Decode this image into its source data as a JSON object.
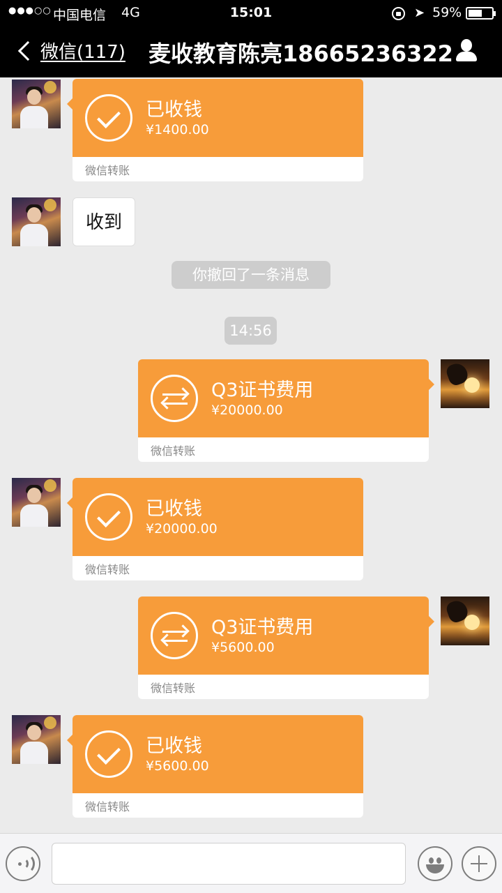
{
  "status_bar": {
    "signal": "●●●○○",
    "carrier": "中国电信",
    "network": "4G",
    "time": "15:01",
    "battery_percent": "59%",
    "battery_level": 0.59
  },
  "nav": {
    "back_label": "微信(117)",
    "title": "麦收教育陈亮18665236322"
  },
  "messages": [
    {
      "title": "已收钱",
      "amount": "¥1400.00",
      "footer": "微信转账"
    },
    {
      "text": "收到"
    },
    {
      "system": "你撤回了一条消息"
    },
    {
      "timestamp": "14:56"
    },
    {
      "title": "Q3证书费用",
      "amount": "¥20000.00",
      "footer": "微信转账"
    },
    {
      "title": "已收钱",
      "amount": "¥20000.00",
      "footer": "微信转账"
    },
    {
      "title": "Q3证书费用",
      "amount": "¥5600.00",
      "footer": "微信转账"
    },
    {
      "title": "已收钱",
      "amount": "¥5600.00",
      "footer": "微信转账"
    }
  ],
  "colors": {
    "transfer_orange": "#f79c3a",
    "chat_background": "#ebebeb",
    "header": "#000000"
  },
  "input_bar": {
    "voice_icon": "voice-icon",
    "emoji_icon": "emoji-icon",
    "plus_icon": "plus-icon",
    "text_value": ""
  }
}
